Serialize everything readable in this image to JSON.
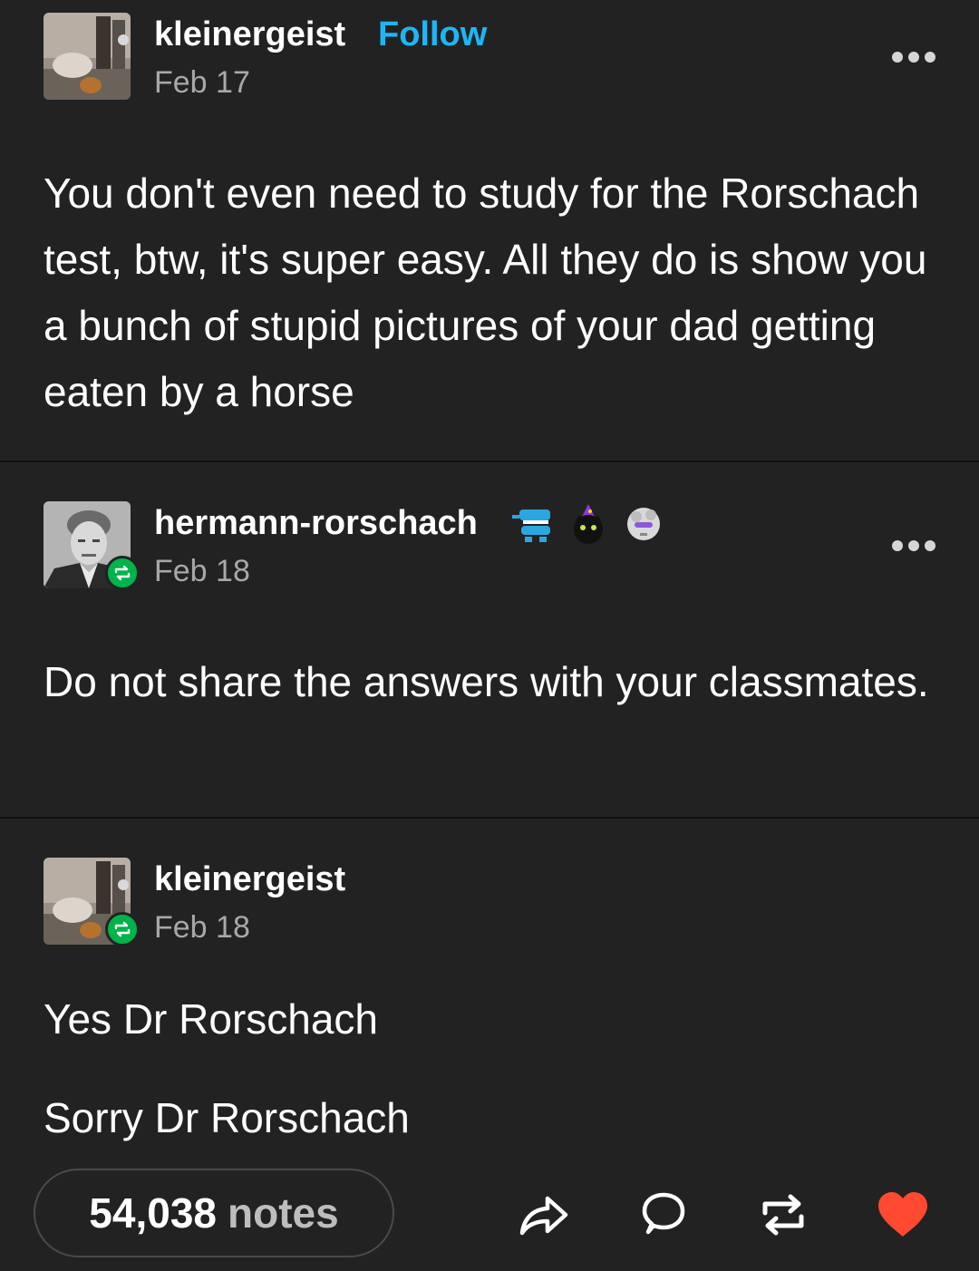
{
  "posts": [
    {
      "username": "kleinergeist",
      "follow_label": "Follow",
      "date": "Feb 17",
      "body": "You don't even need to study for the Rorschach test, btw, it's super easy. All they do is show you a bunch of stupid pictures of your dad getting eaten by a horse",
      "avatar_icon": "skull-still-life-avatar"
    },
    {
      "username": "hermann-rorschach",
      "date": "Feb 18",
      "body": "Do not share the answers with your classmates.",
      "avatar_icon": "portrait-avatar",
      "badges": [
        "chattering-teeth-badge-icon",
        "wizard-cat-badge-icon",
        "statue-head-badge-icon"
      ]
    },
    {
      "username": "kleinergeist",
      "date": "Feb 18",
      "paragraphs": [
        "Yes Dr Rorschach",
        "Sorry Dr Rorschach"
      ],
      "avatar_icon": "skull-still-life-avatar"
    }
  ],
  "footer": {
    "notes_count": "54,038",
    "notes_label": "notes",
    "actions": [
      "share-icon",
      "reply-icon",
      "reblog-icon",
      "like-icon"
    ],
    "like_color": "#ff4930"
  },
  "colors": {
    "background": "#222222",
    "follow": "#1eb6f5",
    "reblog_badge": "#00b34a"
  }
}
